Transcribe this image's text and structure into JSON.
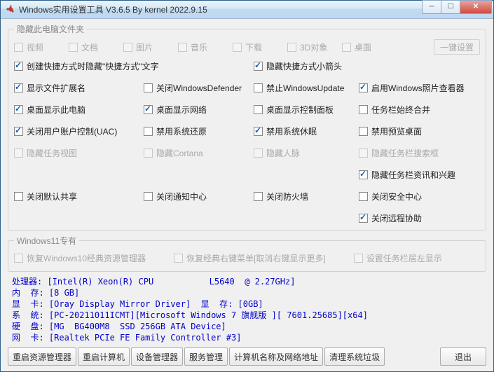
{
  "window": {
    "title": "Windows实用设置工具 V3.6.5 By kernel 2022.9.15"
  },
  "groups": {
    "hideFolders": {
      "legend": "隐藏此电脑文件夹",
      "items": [
        "视频",
        "文档",
        "图片",
        "音乐",
        "下载",
        "3D对象",
        "桌面"
      ],
      "oneKey": "一键设置"
    },
    "win11": {
      "legend": "Windows11专有",
      "opt1": "恢复Windows10经典资源管理器",
      "opt2": "恢复经典右键菜单[取消右键显示更多]",
      "opt3": "设置任务栏居左显示"
    }
  },
  "opts": [
    {
      "label": "创建快捷方式时隐藏\"快捷方式\"文字",
      "checked": true,
      "span": 2
    },
    {
      "label": "隐藏快捷方式小箭头",
      "checked": true
    },
    {
      "label": "",
      "skip": true
    },
    {
      "label": "显示文件扩展名",
      "checked": true
    },
    {
      "label": "关闭WindowsDefender",
      "checked": false
    },
    {
      "label": "禁止WindowsUpdate",
      "checked": false
    },
    {
      "label": "启用Windows照片查看器",
      "checked": true
    },
    {
      "label": "桌面显示此电脑",
      "checked": true
    },
    {
      "label": "桌面显示网络",
      "checked": true
    },
    {
      "label": "桌面显示控制面板",
      "checked": false
    },
    {
      "label": "任务栏始终合并",
      "checked": false
    },
    {
      "label": "关闭用户账户控制(UAC)",
      "checked": true
    },
    {
      "label": "禁用系统还原",
      "checked": false
    },
    {
      "label": "禁用系统休眠",
      "checked": true
    },
    {
      "label": "禁用预览桌面",
      "checked": false
    },
    {
      "label": "隐藏任务视图",
      "checked": false,
      "disabled": true
    },
    {
      "label": "隐藏Cortana",
      "checked": false,
      "disabled": true
    },
    {
      "label": "隐藏人脉",
      "checked": false,
      "disabled": true
    },
    {
      "label": "隐藏任务栏搜索框",
      "checked": false,
      "disabled": true
    },
    {
      "label": "",
      "skip": true
    },
    {
      "label": "",
      "skip": true
    },
    {
      "label": "",
      "skip": true
    },
    {
      "label": "隐藏任务栏资讯和兴趣",
      "checked": true
    },
    {
      "label": "关闭默认共享",
      "checked": false
    },
    {
      "label": "关闭通知中心",
      "checked": false
    },
    {
      "label": "关闭防火墙",
      "checked": false
    },
    {
      "label": "关闭安全中心",
      "checked": false
    },
    {
      "label": "",
      "skip": true
    },
    {
      "label": "",
      "skip": true
    },
    {
      "label": "",
      "skip": true
    },
    {
      "label": "关闭远程协助",
      "checked": true
    }
  ],
  "sysinfo": {
    "l1": "处理器: [Intel(R) Xeon(R) CPU           L5640  @ 2.27GHz]",
    "l2": "内  存: [8 GB]",
    "l3": "显  卡: [Oray Display Mirror Driver]  显  存: [0GB]",
    "l4": "系  统: [PC-20211011ICMT][Microsoft Windows 7 旗舰版 ][ 7601.25685][x64]",
    "l5": "硬  盘: [MG  BG400M8  SSD 256GB ATA Device]",
    "l6": "网  卡: [Realtek PCIe FE Family Controller #3]"
  },
  "buttons": {
    "restartExplorer": "重启资源管理器",
    "restartPc": "重启计算机",
    "devMgr": "设备管理器",
    "svcMgr": "服务管理",
    "pcNameNet": "计算机名称及网络地址",
    "cleanTrash": "清理系统垃圾",
    "exit": "退出"
  }
}
